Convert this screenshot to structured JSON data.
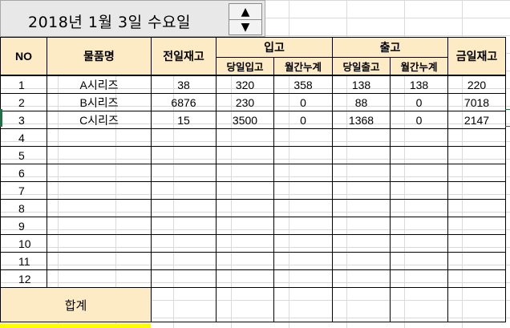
{
  "date_display": "2018년 1월 3일 수요일",
  "spinner": {
    "up_icon": "▲",
    "down_icon": "▼"
  },
  "headers": {
    "no": "NO",
    "item": "물품명",
    "prev_stock": "전일재고",
    "inbound": "입고",
    "outbound": "출고",
    "today_stock": "금일재고",
    "inbound_today": "당일입고",
    "inbound_monthly": "월간누계",
    "outbound_today": "당일출고",
    "outbound_monthly": "월간누계"
  },
  "rows": [
    {
      "no": "1",
      "item": "A시리즈",
      "prev": "38",
      "in_today": "320",
      "in_month": "358",
      "out_today": "138",
      "out_month": "138",
      "today": "220"
    },
    {
      "no": "2",
      "item": "B시리즈",
      "prev": "6876",
      "in_today": "230",
      "in_month": "0",
      "out_today": "88",
      "out_month": "0",
      "today": "7018"
    },
    {
      "no": "3",
      "item": "C시리즈",
      "prev": "15",
      "in_today": "3500",
      "in_month": "0",
      "out_today": "1368",
      "out_month": "0",
      "today": "2147"
    },
    {
      "no": "4",
      "item": "",
      "prev": "",
      "in_today": "",
      "in_month": "",
      "out_today": "",
      "out_month": "",
      "today": ""
    },
    {
      "no": "5",
      "item": "",
      "prev": "",
      "in_today": "",
      "in_month": "",
      "out_today": "",
      "out_month": "",
      "today": ""
    },
    {
      "no": "6",
      "item": "",
      "prev": "",
      "in_today": "",
      "in_month": "",
      "out_today": "",
      "out_month": "",
      "today": ""
    },
    {
      "no": "7",
      "item": "",
      "prev": "",
      "in_today": "",
      "in_month": "",
      "out_today": "",
      "out_month": "",
      "today": ""
    },
    {
      "no": "8",
      "item": "",
      "prev": "",
      "in_today": "",
      "in_month": "",
      "out_today": "",
      "out_month": "",
      "today": ""
    },
    {
      "no": "9",
      "item": "",
      "prev": "",
      "in_today": "",
      "in_month": "",
      "out_today": "",
      "out_month": "",
      "today": ""
    },
    {
      "no": "10",
      "item": "",
      "prev": "",
      "in_today": "",
      "in_month": "",
      "out_today": "",
      "out_month": "",
      "today": ""
    },
    {
      "no": "11",
      "item": "",
      "prev": "",
      "in_today": "",
      "in_month": "",
      "out_today": "",
      "out_month": "",
      "today": ""
    },
    {
      "no": "12",
      "item": "",
      "prev": "",
      "in_today": "",
      "in_month": "",
      "out_today": "",
      "out_month": "",
      "today": ""
    }
  ],
  "total_label": "합계",
  "colors": {
    "header_bg": "#fdebc6",
    "date_bar_bg": "#e8e8e8",
    "highlight": "#ffff00",
    "selection": "#1e7145"
  }
}
